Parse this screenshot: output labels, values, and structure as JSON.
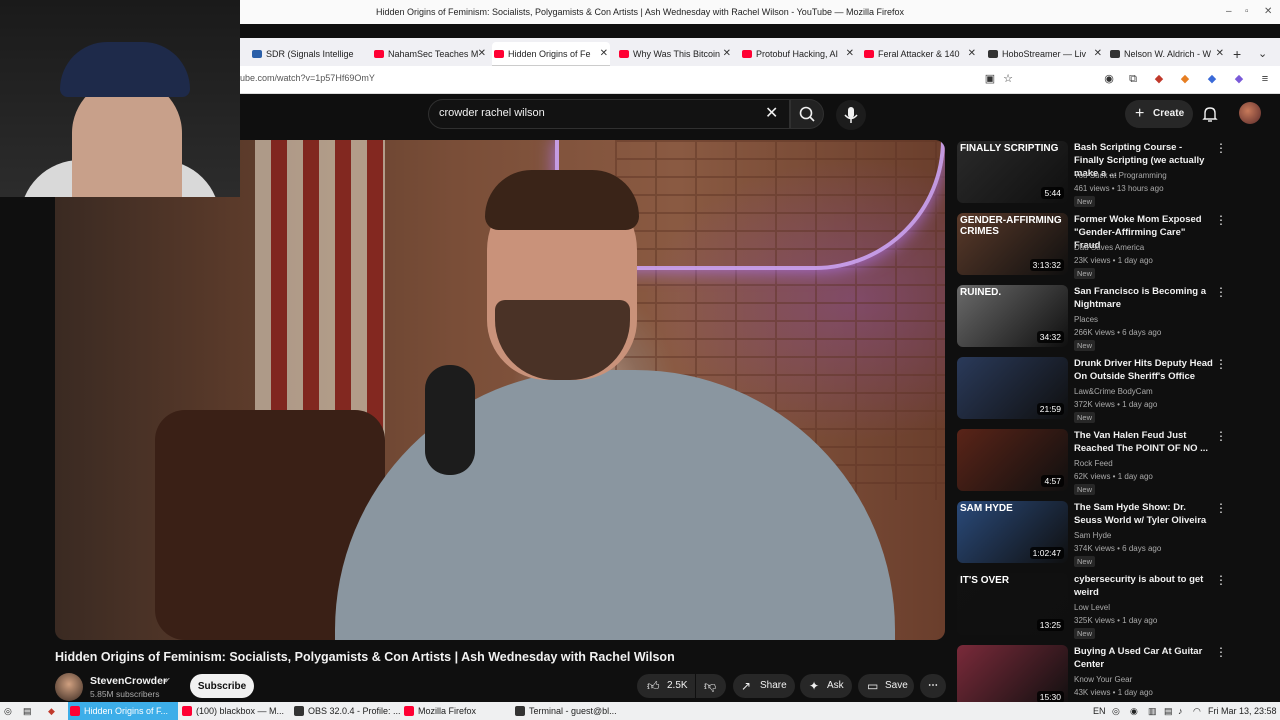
{
  "window": {
    "title": "Hidden Origins of Feminism: Socialists, Polygamists & Con Artists | Ash Wednesday with Rachel Wilson - YouTube — Mozilla Firefox"
  },
  "tabs": [
    {
      "label": "SDR (Signals Intellige",
      "color": "#2b5fa8"
    },
    {
      "label": "NahamSec Teaches M",
      "color": "#ff0033"
    },
    {
      "label": "Hidden Origins of Fe",
      "color": "#ff0033",
      "active": true
    },
    {
      "label": "Why Was This Bitcoin",
      "color": "#ff0033"
    },
    {
      "label": "Protobuf Hacking, AI",
      "color": "#ff0033"
    },
    {
      "label": "Feral Attacker & 140",
      "color": "#ff0033"
    },
    {
      "label": "HoboStreamer — Liv",
      "color": "#333333"
    },
    {
      "label": "Nelson W. Aldrich - W",
      "color": "#333333"
    }
  ],
  "nav": {
    "url": "ube.com/watch?v=1p57Hf69OmY"
  },
  "search": {
    "query": "crowder rachel wilson"
  },
  "masthead": {
    "create_label": "Create"
  },
  "video": {
    "title": "Hidden Origins of Feminism: Socialists, Polygamists & Con Artists | Ash Wednesday with Rachel Wilson",
    "channel": "StevenCrowder",
    "subscribers": "5.85M subscribers",
    "subscribe_label": "Subscribe",
    "likes": "2.5K",
    "share_label": "Share",
    "ask_label": "Ask",
    "save_label": "Save"
  },
  "recommendations": [
    {
      "title": "Bash Scripting Course - Finally Scripting (we actually make a ...",
      "channel": "You Suck at Programming",
      "meta": "461 views • 13 hours ago",
      "badge": "New",
      "duration": "5:44",
      "thumb_text": "FINALLY SCRIPTING",
      "thumb_color": "#2a2a2a"
    },
    {
      "title": "Former Woke Mom Exposed \"Gender-Affirming Care\" Fraud",
      "channel": "Dad Saves America",
      "meta": "23K views • 1 day ago",
      "badge": "New",
      "duration": "3:13:32",
      "thumb_text": "GENDER-AFFIRMING CRIMES",
      "thumb_color": "#5a3a2a"
    },
    {
      "title": "San Francisco is Becoming a Nightmare",
      "channel": "Places",
      "meta": "266K views • 6 days ago",
      "badge": "New",
      "duration": "34:32",
      "thumb_text": "RUINED.",
      "thumb_color": "#6a6a6a"
    },
    {
      "title": "Drunk Driver Hits Deputy Head On Outside Sheriff's Office",
      "channel": "Law&Crime BodyCam",
      "meta": "372K views • 1 day ago",
      "badge": "New",
      "duration": "21:59",
      "thumb_text": "",
      "thumb_color": "#2a3a5a"
    },
    {
      "title": "The Van Halen Feud Just Reached The POINT OF NO ...",
      "channel": "Rock Feed",
      "meta": "62K views • 1 day ago",
      "badge": "New",
      "duration": "4:57",
      "thumb_text": "",
      "thumb_color": "#5a2418"
    },
    {
      "title": "The Sam Hyde Show: Dr. Seuss World w/ Tyler Oliveira",
      "channel": "Sam Hyde",
      "meta": "374K views • 6 days ago",
      "badge": "New",
      "duration": "1:02:47",
      "thumb_text": "SAM HYDE",
      "thumb_color": "#2a4a7a"
    },
    {
      "title": "cybersecurity is about to get weird",
      "channel": "Low Level",
      "meta": "325K views • 1 day ago",
      "badge": "New",
      "duration": "13:25",
      "thumb_text": "IT'S OVER",
      "thumb_color": "#111111"
    },
    {
      "title": "Buying A Used Car At Guitar Center",
      "channel": "Know Your Gear",
      "meta": "43K views • 1 day ago",
      "badge": "",
      "duration": "15:30",
      "thumb_text": "",
      "thumb_color": "#7a2a3a"
    }
  ],
  "taskbar": {
    "items": [
      {
        "label": "Hidden Origins of F...",
        "color": "#ff0033",
        "active": true
      },
      {
        "label": "(100) blackbox — M...",
        "color": "#ff0033"
      },
      {
        "label": "OBS 32.0.4 - Profile: ...",
        "color": "#333333"
      },
      {
        "label": "Mozilla Firefox",
        "color": "#ff0033"
      },
      {
        "label": "Terminal - guest@bl...",
        "color": "#333333"
      }
    ],
    "lang": "EN",
    "clock": "Fri Mar 13, 23:58"
  }
}
